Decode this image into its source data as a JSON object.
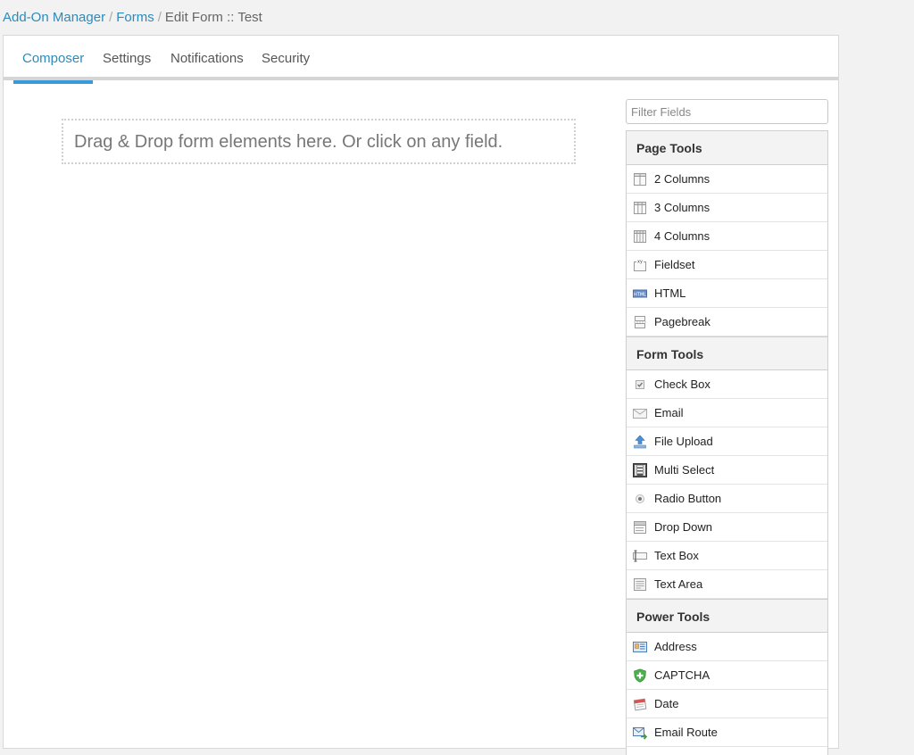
{
  "breadcrumb": {
    "items": [
      "Add-On Manager",
      "Forms"
    ],
    "current": "Edit Form :: Test",
    "separator": "/"
  },
  "tabs": [
    {
      "label": "Composer",
      "active": true
    },
    {
      "label": "Settings",
      "active": false
    },
    {
      "label": "Notifications",
      "active": false
    },
    {
      "label": "Security",
      "active": false
    }
  ],
  "composer": {
    "dropzone_text": "Drag & Drop form elements here. Or click on any field."
  },
  "filter": {
    "placeholder": "Filter Fields"
  },
  "toolbox": {
    "groups": [
      {
        "title": "Page Tools",
        "items": [
          {
            "label": "2 Columns",
            "icon": "two-columns-icon"
          },
          {
            "label": "3 Columns",
            "icon": "three-columns-icon"
          },
          {
            "label": "4 Columns",
            "icon": "four-columns-icon"
          },
          {
            "label": "Fieldset",
            "icon": "fieldset-icon"
          },
          {
            "label": "HTML",
            "icon": "html-icon"
          },
          {
            "label": "Pagebreak",
            "icon": "pagebreak-icon"
          }
        ]
      },
      {
        "title": "Form Tools",
        "items": [
          {
            "label": "Check Box",
            "icon": "checkbox-icon"
          },
          {
            "label": "Email",
            "icon": "email-icon"
          },
          {
            "label": "File Upload",
            "icon": "file-upload-icon"
          },
          {
            "label": "Multi Select",
            "icon": "multi-select-icon"
          },
          {
            "label": "Radio Button",
            "icon": "radio-button-icon"
          },
          {
            "label": "Drop Down",
            "icon": "drop-down-icon"
          },
          {
            "label": "Text Box",
            "icon": "text-box-icon"
          },
          {
            "label": "Text Area",
            "icon": "text-area-icon"
          }
        ]
      },
      {
        "title": "Power Tools",
        "items": [
          {
            "label": "Address",
            "icon": "address-icon"
          },
          {
            "label": "CAPTCHA",
            "icon": "captcha-shield-icon"
          },
          {
            "label": "Date",
            "icon": "date-calendar-icon"
          },
          {
            "label": "Email Route",
            "icon": "email-route-icon"
          }
        ]
      }
    ]
  },
  "colors": {
    "accent": "#2e8ab8",
    "tab_underline": "#3a9ad9",
    "panel_bg": "#ffffff",
    "page_bg": "#f2f2f2"
  }
}
